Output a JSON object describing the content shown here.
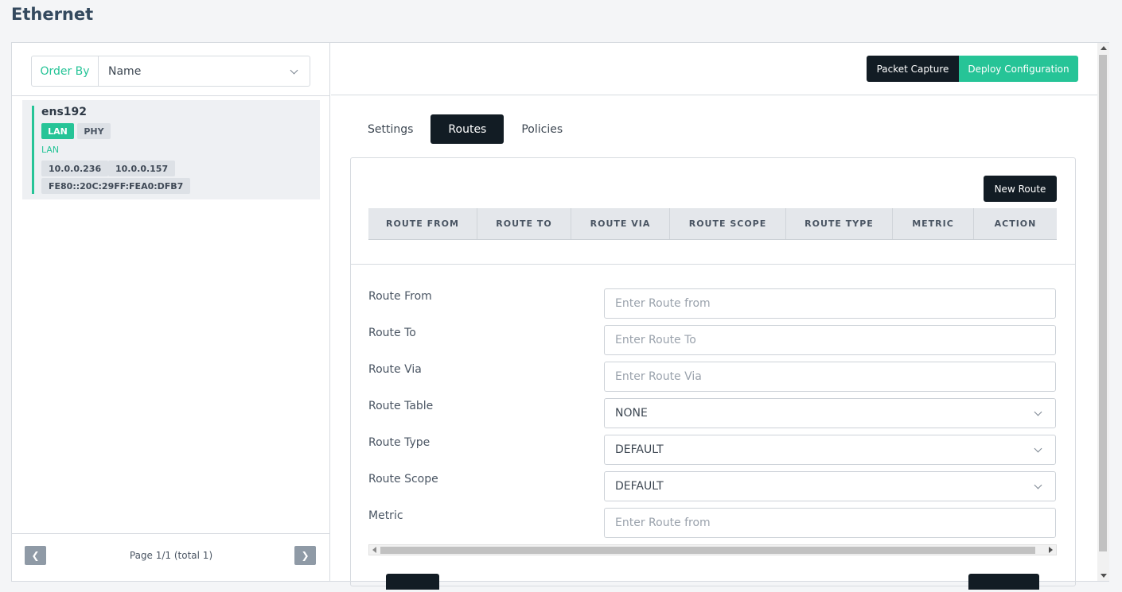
{
  "page": {
    "title": "Ethernet"
  },
  "sidebar": {
    "order_by_label": "Order By",
    "order_by_value": "Name",
    "interfaces": [
      {
        "name": "ens192",
        "badges": [
          "LAN",
          "PHY"
        ],
        "zone": "LAN",
        "addresses": [
          "10.0.0.236",
          "10.0.0.157",
          "FE80::20C:29FF:FEA0:DFB7"
        ]
      }
    ],
    "pagination": {
      "prev_icon": "chevron-left-icon",
      "next_icon": "chevron-right-icon",
      "text": "Page 1/1 (total 1)"
    }
  },
  "toolbar": {
    "packet_capture": "Packet Capture",
    "deploy": "Deploy Configuration"
  },
  "tabs": [
    {
      "label": "Settings",
      "active": false
    },
    {
      "label": "Routes",
      "active": true
    },
    {
      "label": "Policies",
      "active": false
    }
  ],
  "routes": {
    "new_route_label": "New Route",
    "columns": [
      "ROUTE FROM",
      "ROUTE TO",
      "ROUTE VIA",
      "ROUTE SCOPE",
      "ROUTE TYPE",
      "METRIC",
      "ACTION"
    ],
    "rows": []
  },
  "form": {
    "route_from": {
      "label": "Route From",
      "placeholder": "Enter Route from"
    },
    "route_to": {
      "label": "Route To",
      "placeholder": "Enter Route To"
    },
    "route_via": {
      "label": "Route Via",
      "placeholder": "Enter Route Via"
    },
    "route_table": {
      "label": "Route Table",
      "value": "NONE"
    },
    "route_type": {
      "label": "Route Type",
      "value": "DEFAULT"
    },
    "route_scope": {
      "label": "Route Scope",
      "value": "DEFAULT"
    },
    "metric": {
      "label": "Metric",
      "placeholder": "Enter Route from"
    }
  },
  "colors": {
    "accent": "#26c497",
    "dark": "#121c24",
    "muted": "#8f9aa6"
  }
}
